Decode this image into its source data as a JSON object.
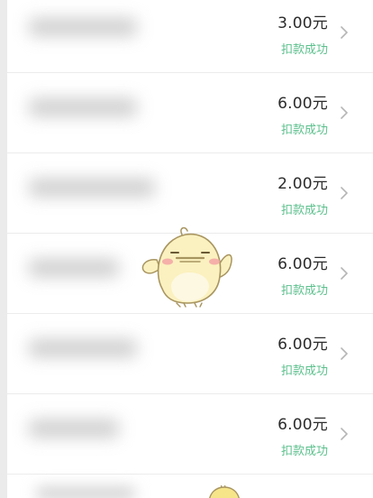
{
  "transactions": [
    {
      "amount": "3.00元",
      "status": "扣款成功"
    },
    {
      "amount": "6.00元",
      "status": "扣款成功"
    },
    {
      "amount": "2.00元",
      "status": "扣款成功"
    },
    {
      "amount": "6.00元",
      "status": "扣款成功"
    },
    {
      "amount": "6.00元",
      "status": "扣款成功"
    },
    {
      "amount": "6.00元",
      "status": "扣款成功"
    }
  ],
  "icons": {
    "row_arrow": "chevron-right-icon",
    "sticker": "chick-mascot-icon"
  },
  "colors": {
    "success": "#5cc08d",
    "amount_text": "#2b2b2b",
    "background": "#f2f2f2",
    "row_background": "#ffffff"
  }
}
